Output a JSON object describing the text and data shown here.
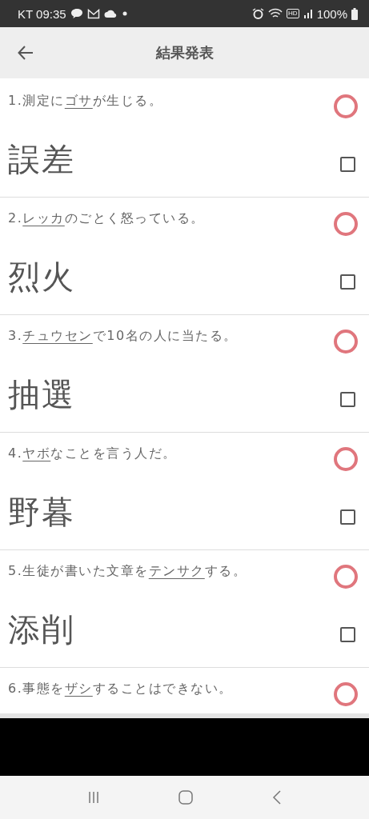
{
  "status_bar": {
    "carrier_time": "KT 09:35",
    "hd_badge": "HD",
    "battery": "100%"
  },
  "header": {
    "title": "結果発表"
  },
  "questions": [
    {
      "before": "1.測定に",
      "underlined": "ゴサ",
      "after": "が生じる。",
      "answer": "誤差",
      "correct": true,
      "checked": false
    },
    {
      "before": "2.",
      "underlined": "レッカ",
      "after": "のごとく怒っている。",
      "answer": "烈火",
      "correct": true,
      "checked": false
    },
    {
      "before": "3.",
      "underlined": "チュウセン",
      "after": "で10名の人に当たる。",
      "answer": "抽選",
      "correct": true,
      "checked": false
    },
    {
      "before": "4.",
      "underlined": "ヤボ",
      "after": "なことを言う人だ。",
      "answer": "野暮",
      "correct": true,
      "checked": false
    },
    {
      "before": "5.生徒が書いた文章を",
      "underlined": "テンサク",
      "after": "する。",
      "answer": "添削",
      "correct": true,
      "checked": false
    },
    {
      "before": "6.事態を",
      "underlined": "ザシ",
      "after": "することはできない。",
      "correct": true
    }
  ]
}
